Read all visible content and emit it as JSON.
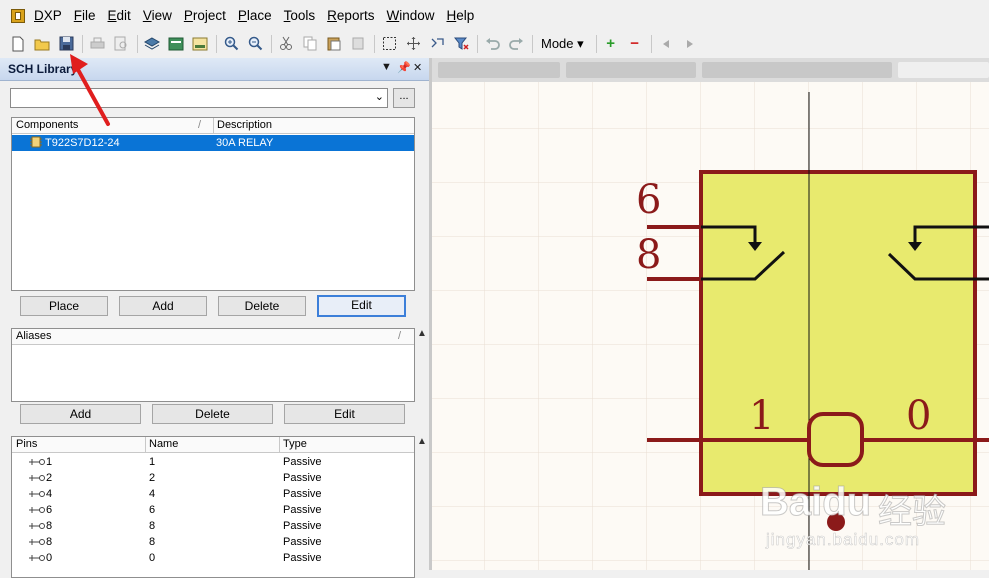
{
  "menu": {
    "items": [
      "DXP",
      "File",
      "Edit",
      "View",
      "Project",
      "Place",
      "Tools",
      "Reports",
      "Window",
      "Help"
    ]
  },
  "toolbar": {
    "mode_label": "Mode ▾"
  },
  "panel": {
    "title": "SCH Library",
    "browse_label": "...",
    "components": {
      "headers": [
        "Components",
        "Description"
      ],
      "rows": [
        {
          "name": "T922S7D12-24",
          "description": "30A RELAY",
          "selected": true
        }
      ]
    },
    "component_buttons": [
      "Place",
      "Add",
      "Delete",
      "Edit"
    ],
    "aliases": {
      "header": "Aliases"
    },
    "alias_buttons": [
      "Add",
      "Delete",
      "Edit"
    ],
    "pins": {
      "headers": [
        "Pins",
        "Name",
        "Type"
      ],
      "rows": [
        {
          "pin": "1",
          "name": "1",
          "type": "Passive"
        },
        {
          "pin": "2",
          "name": "2",
          "type": "Passive"
        },
        {
          "pin": "4",
          "name": "4",
          "type": "Passive"
        },
        {
          "pin": "6",
          "name": "6",
          "type": "Passive"
        },
        {
          "pin": "8",
          "name": "8",
          "type": "Passive"
        },
        {
          "pin": "8",
          "name": "8",
          "type": "Passive"
        },
        {
          "pin": "0",
          "name": "0",
          "type": "Passive"
        }
      ]
    }
  },
  "schematic": {
    "pin_numbers": [
      "6",
      "8",
      "1",
      "0"
    ],
    "body_color": "#e8ea6e",
    "outline_color": "#8b1a1a",
    "annotation_arrow_color": "#e01e1e"
  },
  "watermark": {
    "brand": "Baidu",
    "brand_cn": "经验",
    "url": "jingyan.baidu.com"
  }
}
